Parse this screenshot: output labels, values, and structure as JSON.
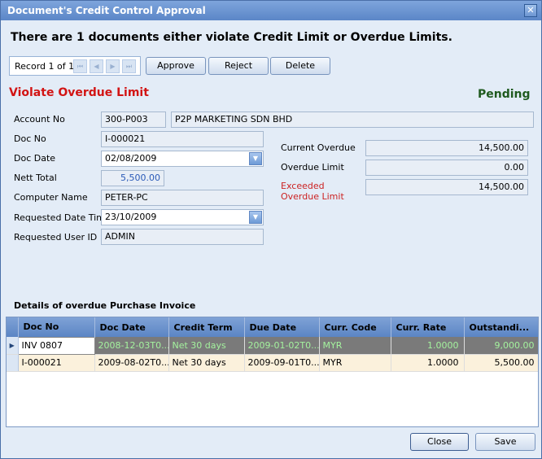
{
  "window": {
    "title": "Document's Credit Control Approval"
  },
  "heading": "There are 1 documents either violate Credit Limit or Overdue Limits.",
  "navigator": {
    "record_text": "Record 1 of 1"
  },
  "toolbar": {
    "approve": "Approve",
    "reject": "Reject",
    "delete": "Delete"
  },
  "status": {
    "violation": "Violate Overdue Limit",
    "state": "Pending"
  },
  "form": {
    "account_no_label": "Account No",
    "account_no": "300-P003",
    "account_name": "P2P MARKETING SDN BHD",
    "doc_no_label": "Doc No",
    "doc_no": "I-000021",
    "doc_date_label": "Doc Date",
    "doc_date": "02/08/2009",
    "nett_total_label": "Nett Total",
    "nett_total": "5,500.00",
    "computer_name_label": "Computer Name",
    "computer_name": "PETER-PC",
    "requested_date_label": "Requested Date Time",
    "requested_date": "23/10/2009",
    "requested_user_label": "Requested User ID",
    "requested_user": "ADMIN",
    "current_overdue_label": "Current Overdue",
    "current_overdue": "14,500.00",
    "overdue_limit_label": "Overdue Limit",
    "overdue_limit": "0.00",
    "exceeded_label": "Exceeded Overdue Limit",
    "exceeded_overdue": "14,500.00"
  },
  "grid": {
    "title": "Details of overdue Purchase Invoice",
    "columns": [
      "Doc No",
      "Doc Date",
      "Credit Term",
      "Due Date",
      "Curr. Code",
      "Curr. Rate",
      "Outstandi..."
    ],
    "rows": [
      [
        "INV 0807",
        "2008-12-03T0...",
        "Net 30 days",
        "2009-01-02T0...",
        "MYR",
        "1.0000",
        "9,000.00"
      ],
      [
        "I-000021",
        "2009-08-02T0...",
        "Net 30 days",
        "2009-09-01T0...",
        "MYR",
        "1.0000",
        "5,500.00"
      ]
    ]
  },
  "footer": {
    "close": "Close",
    "save": "Save"
  }
}
